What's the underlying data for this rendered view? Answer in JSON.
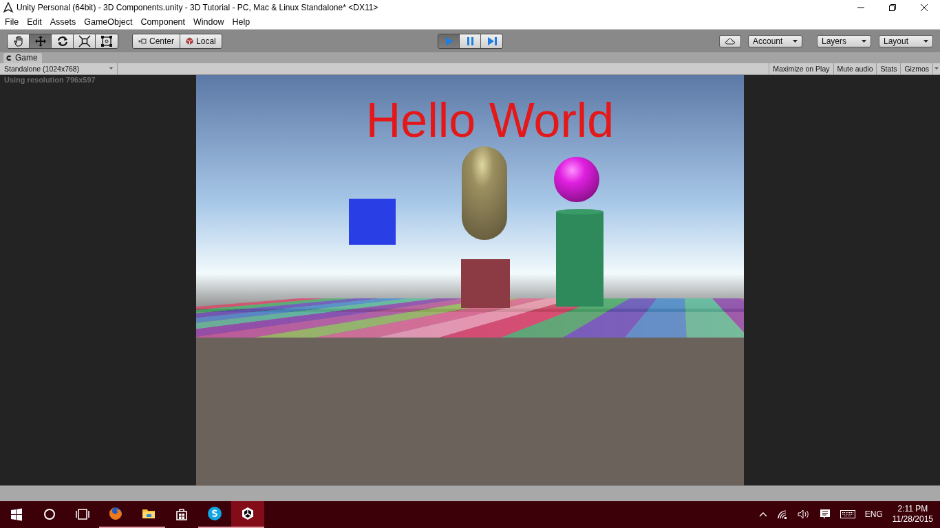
{
  "window": {
    "title": "Unity Personal (64bit) - 3D Components.unity - 3D Tutorial - PC, Mac & Linux Standalone* <DX11>"
  },
  "menu": [
    "File",
    "Edit",
    "Assets",
    "GameObject",
    "Component",
    "Window",
    "Help"
  ],
  "toolbar": {
    "tools": [
      {
        "kind": "hand",
        "selected": false
      },
      {
        "kind": "move",
        "selected": true
      },
      {
        "kind": "rotate",
        "selected": false
      },
      {
        "kind": "scale",
        "selected": false
      },
      {
        "kind": "rect",
        "selected": false
      }
    ],
    "pivot": [
      {
        "kind": "center",
        "label": "Center"
      },
      {
        "kind": "local",
        "label": "Local"
      }
    ],
    "playback": [
      {
        "kind": "play",
        "selected": true
      },
      {
        "kind": "pause",
        "selected": false
      },
      {
        "kind": "step",
        "selected": false
      }
    ],
    "dropdowns": [
      "Account",
      "Layers",
      "Layout"
    ]
  },
  "game_panel": {
    "tab": "Game",
    "aspect": "Standalone (1024x768)",
    "options": [
      "Maximize on Play",
      "Mute audio",
      "Stats",
      "Gizmos"
    ],
    "resolution_note": "Using resolution 796x597",
    "scene_text": "Hello World"
  },
  "taskbar": {
    "apps": [
      {
        "kind": "start",
        "running": false,
        "active": false
      },
      {
        "kind": "search",
        "running": false,
        "active": false
      },
      {
        "kind": "taskview",
        "running": false,
        "active": false
      },
      {
        "kind": "firefox",
        "running": true,
        "active": false
      },
      {
        "kind": "explorer",
        "running": true,
        "active": false
      },
      {
        "kind": "store",
        "running": false,
        "active": false
      },
      {
        "kind": "skype",
        "running": true,
        "active": false
      },
      {
        "kind": "unity",
        "running": true,
        "active": true
      }
    ],
    "tray": {
      "language": "ENG",
      "time": "2:11 PM",
      "date": "11/28/2015"
    }
  }
}
